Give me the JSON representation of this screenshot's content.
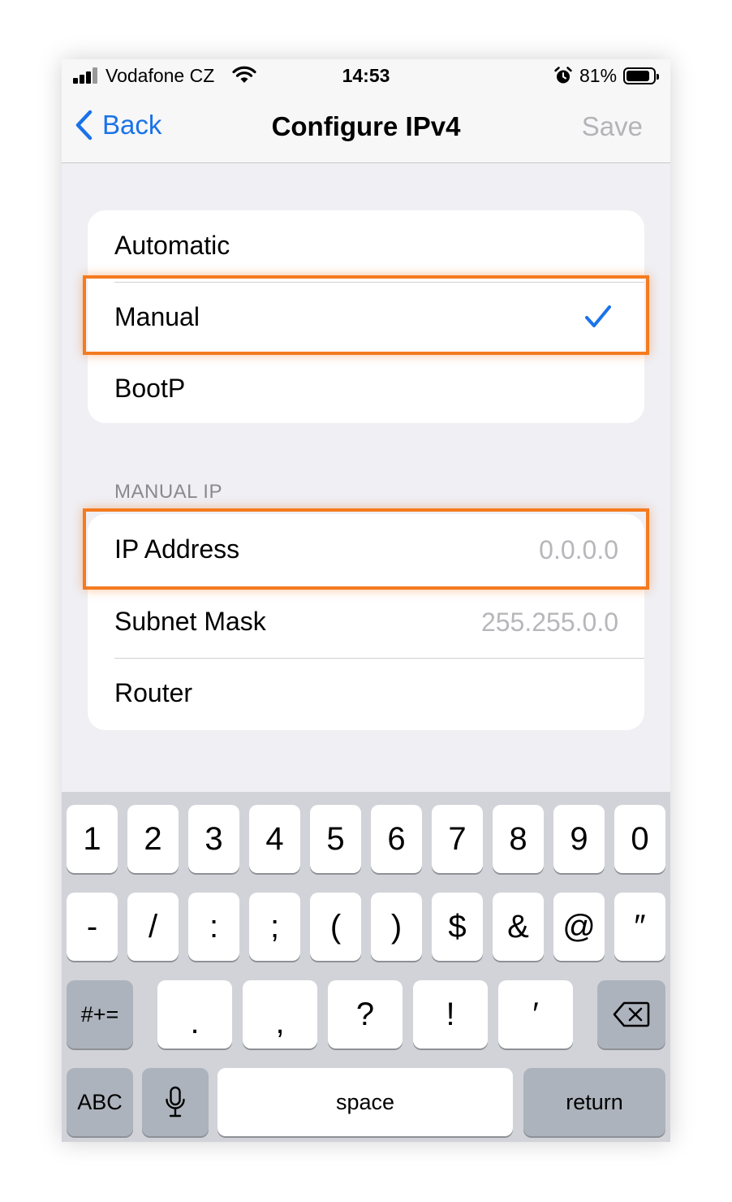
{
  "status_bar": {
    "carrier": "Vodafone CZ",
    "time": "14:53",
    "battery_percent": "81%",
    "battery_level": 0.81,
    "icons": [
      "signal-icon",
      "wifi-icon",
      "alarm-icon",
      "battery-icon"
    ]
  },
  "nav": {
    "back_label": "Back",
    "title": "Configure IPv4",
    "save_label": "Save",
    "accent_color": "#1a73e8"
  },
  "config_options": [
    {
      "label": "Automatic",
      "selected": false
    },
    {
      "label": "Manual",
      "selected": true
    },
    {
      "label": "BootP",
      "selected": false
    }
  ],
  "manual_ip": {
    "header": "MANUAL IP",
    "fields": [
      {
        "label": "IP Address",
        "placeholder": "0.0.0.0"
      },
      {
        "label": "Subnet Mask",
        "placeholder": "255.255.0.0"
      },
      {
        "label": "Router",
        "placeholder": ""
      }
    ]
  },
  "highlight_color": "#f47b20",
  "keyboard": {
    "row1": [
      "1",
      "2",
      "3",
      "4",
      "5",
      "6",
      "7",
      "8",
      "9",
      "0"
    ],
    "row2": [
      "-",
      "/",
      ":",
      ";",
      "(",
      ")",
      "$",
      "&",
      "@",
      "″"
    ],
    "row3_mode": "#+=",
    "row3": [
      ".",
      ",",
      "?",
      "!",
      "′"
    ],
    "delete_icon": "backspace-icon",
    "row4": {
      "abc": "ABC",
      "mic_icon": "microphone-icon",
      "space": "space",
      "return": "return"
    }
  }
}
